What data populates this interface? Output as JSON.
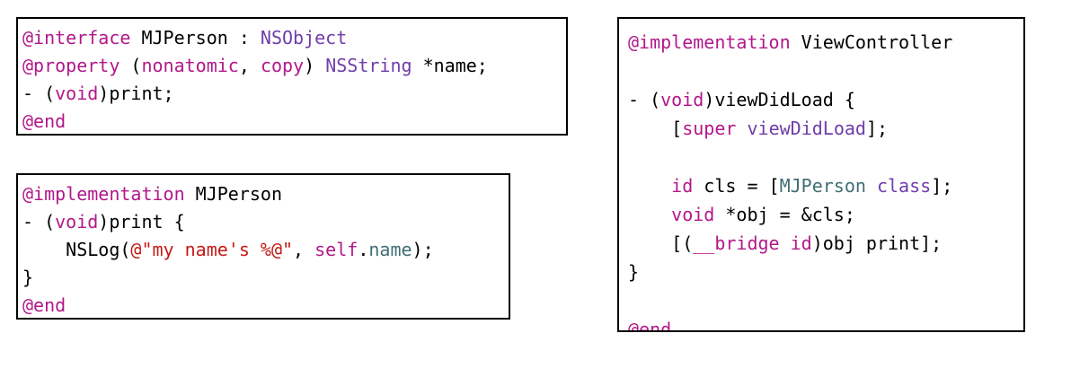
{
  "theme": {
    "keyword_color": "#b21889",
    "type_color": "#703daa",
    "string_color": "#c41a16",
    "property_color": "#3f6e74",
    "text_color": "#000000",
    "border_color": "#000000"
  },
  "snippets": [
    {
      "id": "person-interface",
      "lines": [
        [
          {
            "t": "@interface",
            "k": "kw"
          },
          {
            "t": " MJPerson : ",
            "k": "plain"
          },
          {
            "t": "NSObject",
            "k": "typ"
          }
        ],
        [
          {
            "t": "@property",
            "k": "kw"
          },
          {
            "t": " (",
            "k": "plain"
          },
          {
            "t": "nonatomic",
            "k": "kw"
          },
          {
            "t": ", ",
            "k": "plain"
          },
          {
            "t": "copy",
            "k": "kw"
          },
          {
            "t": ") ",
            "k": "plain"
          },
          {
            "t": "NSString",
            "k": "typ"
          },
          {
            "t": " *name;",
            "k": "plain"
          }
        ],
        [
          {
            "t": "- (",
            "k": "plain"
          },
          {
            "t": "void",
            "k": "kw"
          },
          {
            "t": ")print;",
            "k": "plain"
          }
        ],
        [
          {
            "t": "@end",
            "k": "kw"
          }
        ]
      ]
    },
    {
      "id": "person-implementation",
      "lines": [
        [
          {
            "t": "@implementation",
            "k": "kw"
          },
          {
            "t": " MJPerson",
            "k": "plain"
          }
        ],
        [
          {
            "t": "- (",
            "k": "plain"
          },
          {
            "t": "void",
            "k": "kw"
          },
          {
            "t": ")print {",
            "k": "plain"
          }
        ],
        [
          {
            "t": "    NSLog(",
            "k": "plain"
          },
          {
            "t": "@\"my name's %@\"",
            "k": "str"
          },
          {
            "t": ", ",
            "k": "plain"
          },
          {
            "t": "self",
            "k": "kw"
          },
          {
            "t": ".",
            "k": "plain"
          },
          {
            "t": "name",
            "k": "prop"
          },
          {
            "t": ");",
            "k": "plain"
          }
        ],
        [
          {
            "t": "}",
            "k": "plain"
          }
        ],
        [
          {
            "t": "@end",
            "k": "kw"
          }
        ]
      ]
    },
    {
      "id": "viewcontroller-implementation",
      "lines": [
        [
          {
            "t": "@implementation",
            "k": "kw"
          },
          {
            "t": " ViewController",
            "k": "plain"
          }
        ],
        [],
        [
          {
            "t": "- (",
            "k": "plain"
          },
          {
            "t": "void",
            "k": "kw"
          },
          {
            "t": ")viewDidLoad {",
            "k": "plain"
          }
        ],
        [
          {
            "t": "    [",
            "k": "plain"
          },
          {
            "t": "super",
            "k": "kw"
          },
          {
            "t": " ",
            "k": "plain"
          },
          {
            "t": "viewDidLoad",
            "k": "typ"
          },
          {
            "t": "];",
            "k": "plain"
          }
        ],
        [],
        [
          {
            "t": "    ",
            "k": "plain"
          },
          {
            "t": "id",
            "k": "kw"
          },
          {
            "t": " cls = [",
            "k": "plain"
          },
          {
            "t": "MJPerson",
            "k": "prop"
          },
          {
            "t": " ",
            "k": "plain"
          },
          {
            "t": "class",
            "k": "typ"
          },
          {
            "t": "];",
            "k": "plain"
          }
        ],
        [
          {
            "t": "    ",
            "k": "plain"
          },
          {
            "t": "void",
            "k": "kw"
          },
          {
            "t": " *obj = &cls;",
            "k": "plain"
          }
        ],
        [
          {
            "t": "    [(",
            "k": "plain"
          },
          {
            "t": "__bridge",
            "k": "kw"
          },
          {
            "t": " ",
            "k": "plain"
          },
          {
            "t": "id",
            "k": "kw"
          },
          {
            "t": ")obj print];",
            "k": "plain"
          }
        ],
        [
          {
            "t": "}",
            "k": "plain"
          }
        ],
        [],
        [
          {
            "t": "@end",
            "k": "kw"
          }
        ]
      ]
    }
  ]
}
